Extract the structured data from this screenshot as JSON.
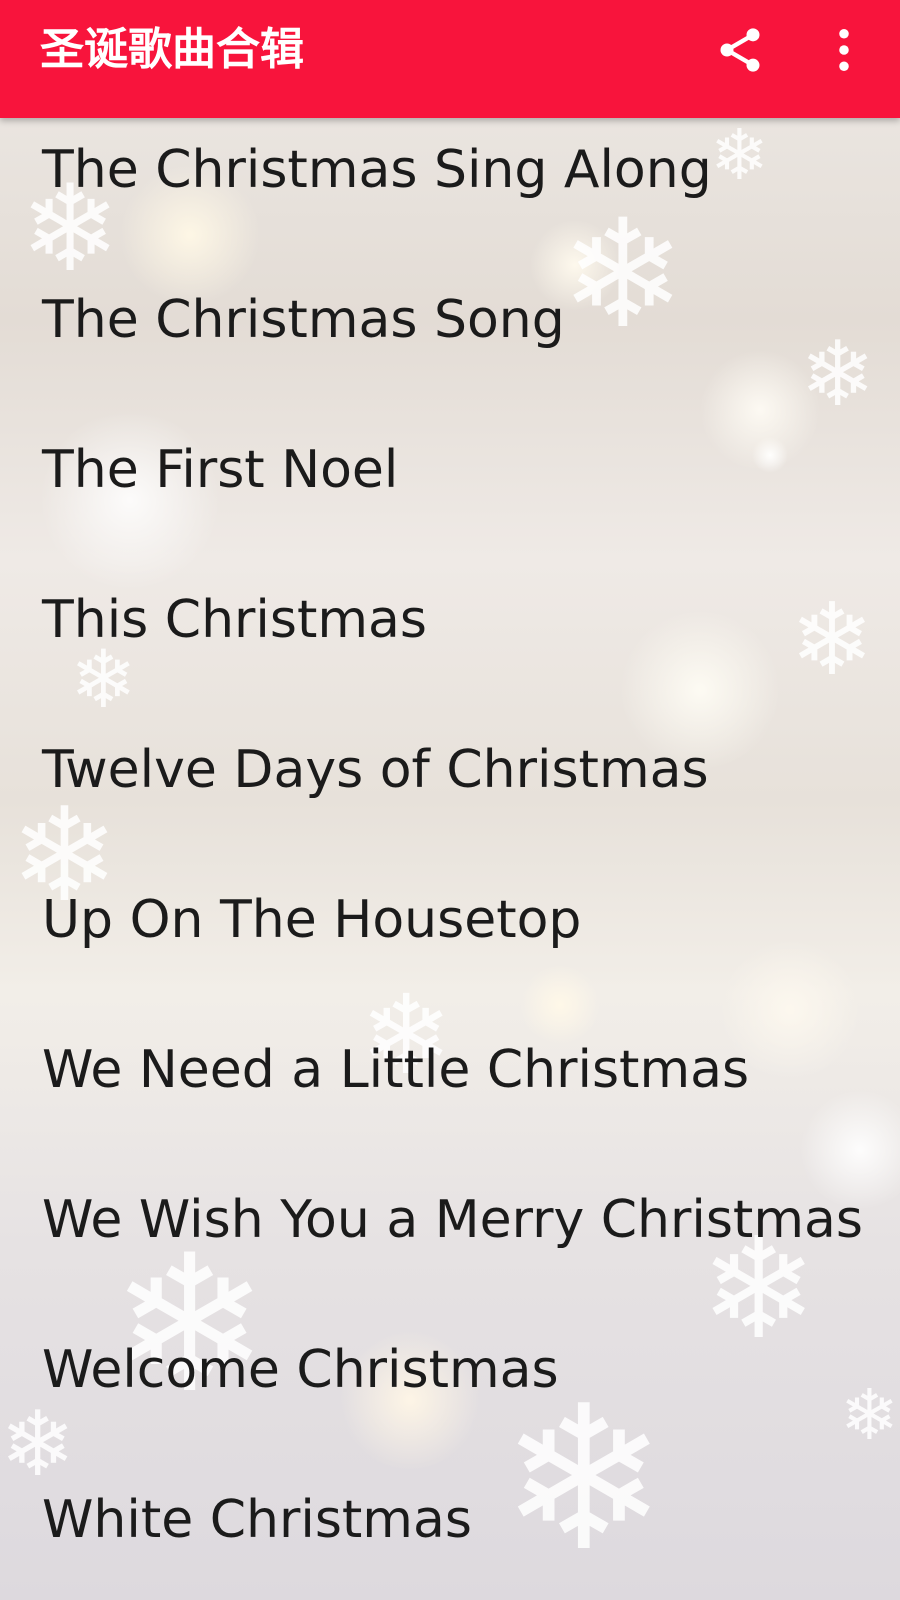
{
  "appbar": {
    "title": "圣诞歌曲合辑",
    "background": "#f8143c",
    "actions": [
      "share-icon",
      "more-vert-icon"
    ]
  },
  "songs": [
    "The Christmas Sing Along",
    "The Christmas Song",
    "The First Noel",
    "This Christmas",
    "Twelve Days of Christmas",
    "Up On The Housetop",
    "We Need a Little Christmas",
    "We Wish You a Merry Christmas",
    "Welcome Christmas",
    "White Christmas"
  ]
}
